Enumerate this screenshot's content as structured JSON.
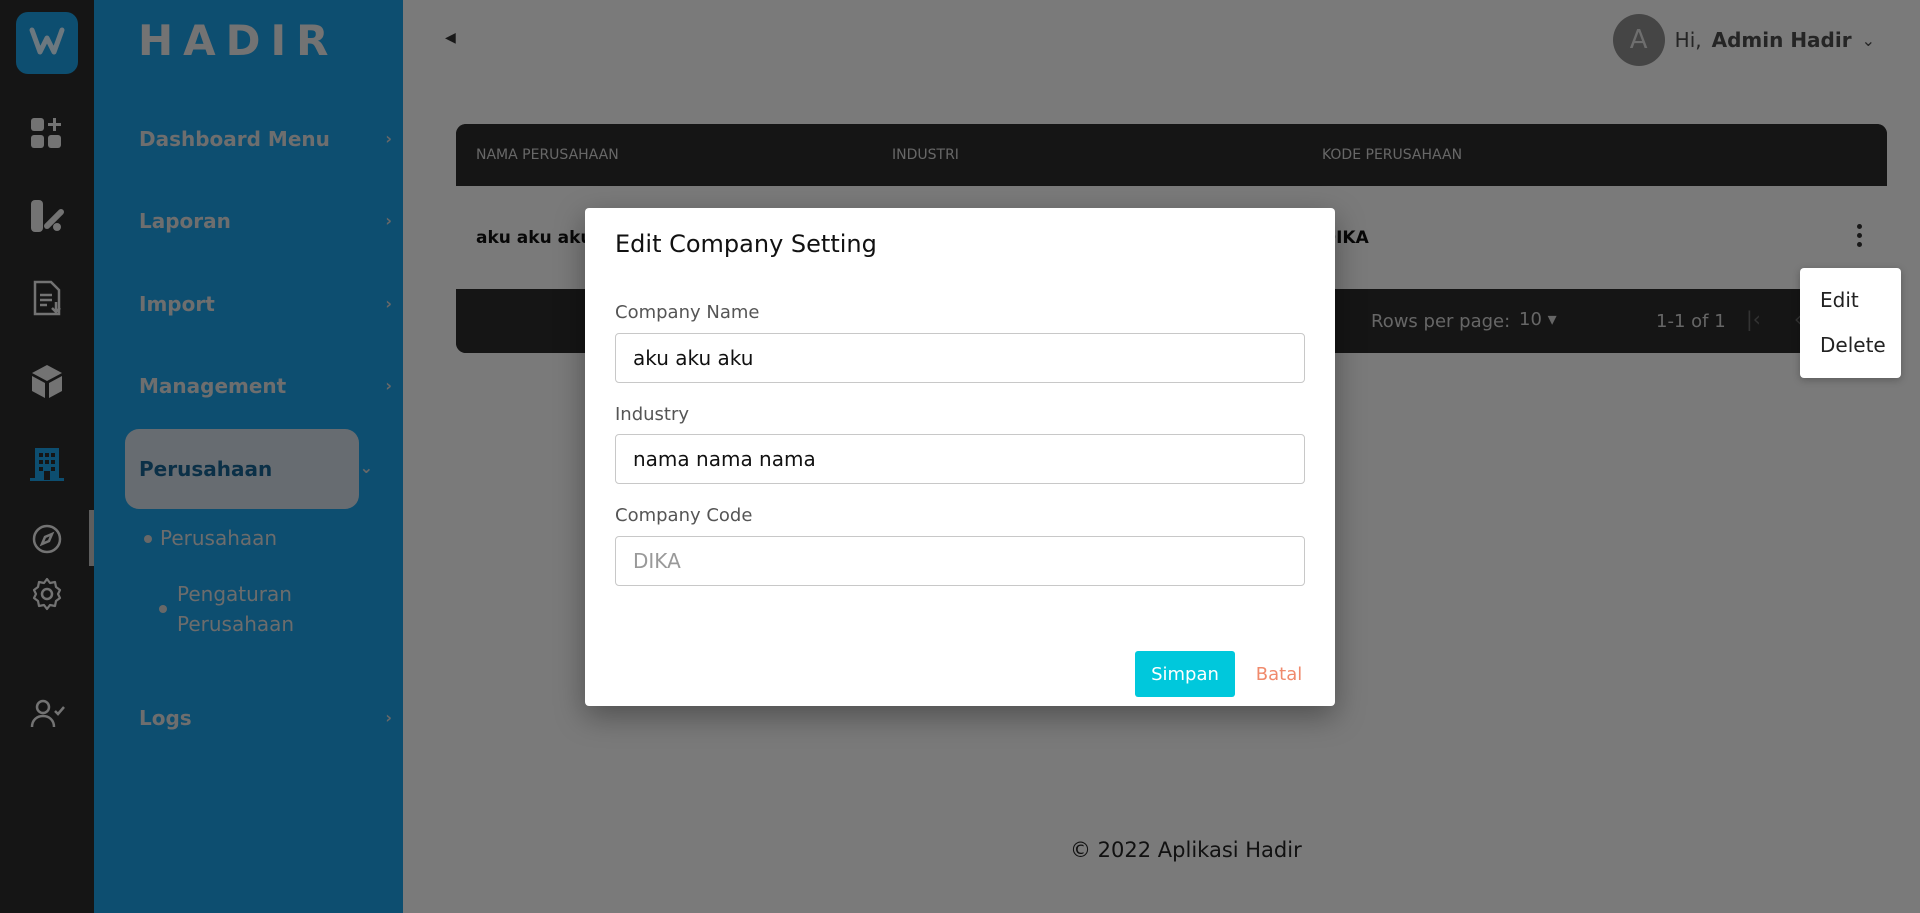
{
  "app": {
    "brand": "HADIR"
  },
  "rail_icons": [
    "logo-icon",
    "dashboard-add-icon",
    "report-icon",
    "import-document-icon",
    "cube-icon",
    "building-icon",
    "compass-icon",
    "gear-icon",
    "user-check-icon"
  ],
  "sidebar": {
    "items": [
      {
        "label": "Dashboard Menu"
      },
      {
        "label": "Laporan"
      },
      {
        "label": "Import"
      },
      {
        "label": "Management"
      },
      {
        "label": "Perusahaan"
      },
      {
        "label": "Logs"
      }
    ],
    "subitems": [
      {
        "label": "Perusahaan"
      },
      {
        "label": "Pengaturan Perusahaan"
      }
    ]
  },
  "header": {
    "avatar_letter": "A",
    "greeting": "Hi,",
    "user_name": "Admin Hadir"
  },
  "table": {
    "columns": [
      "NAMA PERUSAHAAN",
      "INDUSTRI",
      "KODE PERUSAHAAN"
    ],
    "rows": [
      {
        "nama": "aku aku aku",
        "industri": "",
        "kode": "DIKA"
      }
    ],
    "pagination": {
      "rows_per_page_label": "Rows per page:",
      "rows_per_page_value": "10",
      "range": "1-1 of 1"
    }
  },
  "row_menu": {
    "edit": "Edit",
    "delete": "Delete"
  },
  "footer": {
    "text": "© 2022 Aplikasi Hadir"
  },
  "modal": {
    "title": "Edit Company Setting",
    "fields": {
      "company_name": {
        "label": "Company Name",
        "value": "aku aku aku",
        "placeholder": ""
      },
      "industry": {
        "label": "Industry",
        "value": "nama nama nama",
        "placeholder": ""
      },
      "company_code": {
        "label": "Company Code",
        "value": "",
        "placeholder": "DIKA"
      }
    },
    "save_label": "Simpan",
    "cancel_label": "Batal"
  },
  "colors": {
    "primary": "#1a9ce0",
    "accent": "#00c8dc",
    "cancel": "#f08a6c",
    "rail": "#2b2b2b"
  }
}
